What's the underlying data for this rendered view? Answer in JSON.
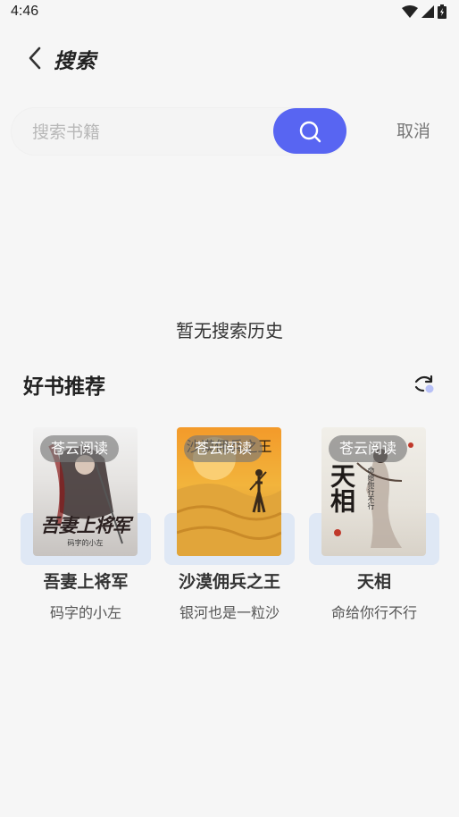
{
  "status": {
    "time": "4:46",
    "icons": [
      "wifi-icon",
      "signal-icon",
      "battery-icon"
    ]
  },
  "header": {
    "back_icon": "chevron-left-icon",
    "title": "搜索"
  },
  "search": {
    "placeholder": "搜索书籍",
    "value": "",
    "button_icon": "search-icon",
    "cancel_label": "取消"
  },
  "history": {
    "empty_text": "暂无搜索历史"
  },
  "recommend": {
    "title": "好书推荐",
    "refresh_icon": "refresh-icon",
    "books": [
      {
        "title": "吾妻上将军",
        "author": "码字的小左",
        "badge": "苍云阅读",
        "cover_text": "吾妻上将军",
        "cover_sub": "码字的小左"
      },
      {
        "title": "沙漠佣兵之王",
        "author": "银河也是一粒沙",
        "badge": "苍云阅读",
        "cover_text": "沙漠佣兵之王"
      },
      {
        "title": "天相",
        "author": "命给你行不行",
        "badge": "苍云阅读",
        "cover_text": "天相",
        "cover_sub": "命给你行不行"
      }
    ]
  },
  "colors": {
    "accent": "#5865f2",
    "background": "#f6f6f6",
    "book_base": "#dfe8f5"
  }
}
